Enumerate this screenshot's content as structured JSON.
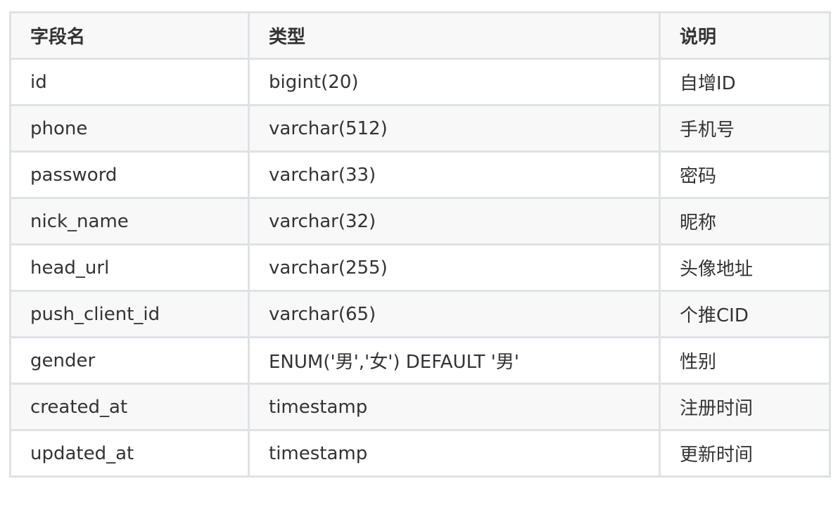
{
  "table": {
    "headers": [
      "字段名",
      "类型",
      "说明"
    ],
    "rows": [
      [
        "id",
        "bigint(20)",
        "自增ID"
      ],
      [
        "phone",
        "varchar(512)",
        "手机号"
      ],
      [
        "password",
        "varchar(33)",
        "密码"
      ],
      [
        "nick_name",
        "varchar(32)",
        "昵称"
      ],
      [
        "head_url",
        "varchar(255)",
        "头像地址"
      ],
      [
        "push_client_id",
        "varchar(65)",
        "个推CID"
      ],
      [
        "gender",
        "ENUM('男','女') DEFAULT '男'",
        "性别"
      ],
      [
        "created_at",
        "timestamp",
        "注册时间"
      ],
      [
        "updated_at",
        "timestamp",
        "更新时间"
      ]
    ]
  }
}
